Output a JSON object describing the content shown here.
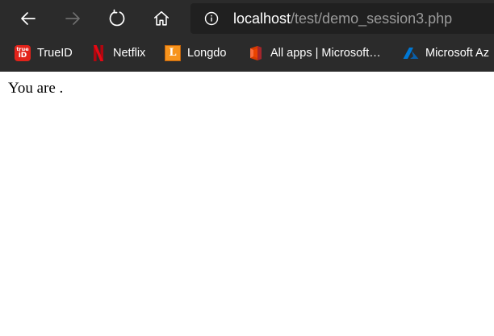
{
  "browser": {
    "address_bar": {
      "host": "localhost",
      "path": "/test/demo_session3.php"
    },
    "nav": {
      "back_icon": "arrow-left-icon",
      "forward_icon": "arrow-right-icon",
      "refresh_icon": "refresh-icon",
      "home_icon": "home-icon",
      "info_icon": "info-icon"
    },
    "bookmarks": [
      {
        "label": "TrueID",
        "icon": "trueid-icon"
      },
      {
        "label": "Netflix",
        "icon": "netflix-icon"
      },
      {
        "label": "Longdo",
        "icon": "longdo-icon"
      },
      {
        "label": "All apps | Microsoft…",
        "icon": "microsoft-office-icon"
      },
      {
        "label": "Microsoft Az",
        "icon": "azure-icon"
      }
    ],
    "bookmark_icon_text": {
      "trueid_top": "true",
      "trueid_bottom": "iD",
      "longdo": "L"
    },
    "colors": {
      "toolbar": "#2b2b2b",
      "address_bar": "#202020",
      "url_host": "#ffffff",
      "url_path": "#9a9a9a",
      "disabled_icon": "#6e6e6e",
      "netflix_red": "#e50914",
      "azure_blue": "#0078d4"
    }
  },
  "page": {
    "text": "You are ."
  }
}
